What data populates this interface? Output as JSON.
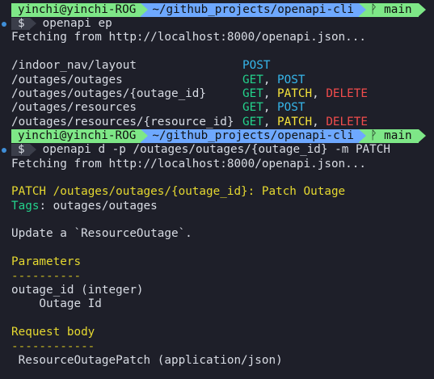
{
  "prompt": {
    "user": "yinchi@yinchi-ROG",
    "path": "~/github_projects/openapi-cli",
    "branch_icon": "git-branch-icon",
    "branch": "main",
    "dollar": "$"
  },
  "commands": [
    "openapi ep",
    "openapi d -p /outages/outages/{outage_id} -m PATCH"
  ],
  "fetch_text": "Fetching from http://localhost:8000/openapi.json...",
  "endpoints": [
    {
      "path": "/indoor_nav/layout",
      "methods": [
        "POST"
      ]
    },
    {
      "path": "/outages/outages",
      "methods": [
        "GET",
        "POST"
      ]
    },
    {
      "path": "/outages/outages/{outage_id}",
      "methods": [
        "GET",
        "PATCH",
        "DELETE"
      ]
    },
    {
      "path": "/outages/resources",
      "methods": [
        "GET",
        "POST"
      ]
    },
    {
      "path": "/outages/resources/{resource_id}",
      "methods": [
        "GET",
        "PATCH",
        "DELETE"
      ]
    }
  ],
  "detail": {
    "method": "PATCH",
    "summary": "/outages/outages/{outage_id}: Patch Outage",
    "tags_label": "Tags",
    "tags_value": ": outages/outages",
    "description": "Update a `ResourceOutage`.",
    "parameters_heading": "Parameters",
    "parameters_underline": "----------",
    "param_line": "outage_id (integer)",
    "param_desc": "    Outage Id",
    "request_body_heading": "Request body",
    "request_body_underline": "------------",
    "request_body_line": " ResourceOutagePatch (application/json)"
  },
  "colors": {
    "background": "#1e1f29",
    "prompt_user": "#7ee787",
    "prompt_path": "#6ea8fe",
    "method_get": "#23d18b",
    "method_post": "#36b6ea",
    "method_patch": "#f5e33b",
    "method_delete": "#f14c4c",
    "heading": "#e5d830"
  }
}
